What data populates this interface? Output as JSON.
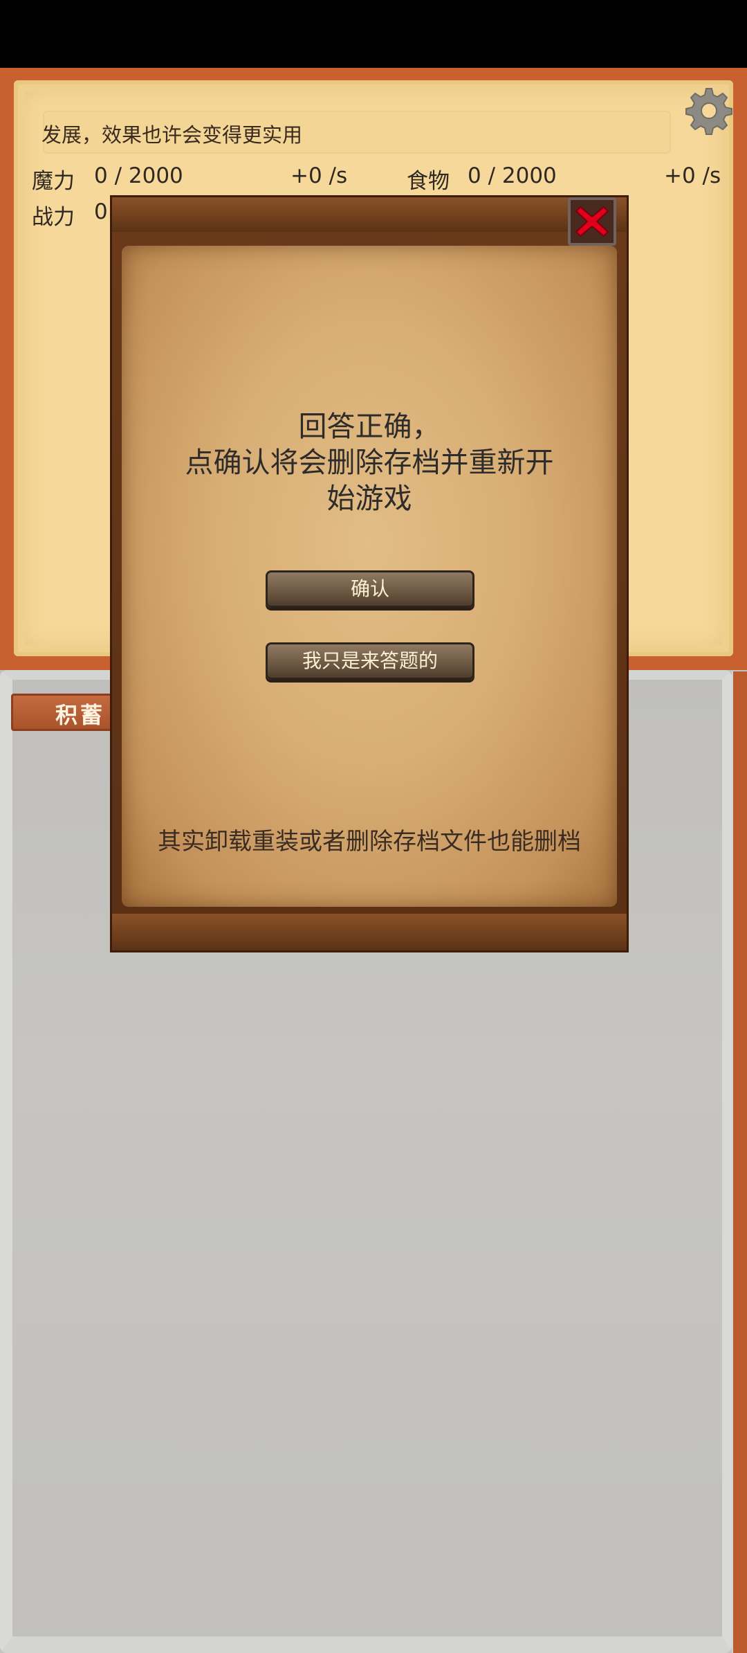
{
  "top_panel": {
    "message": "发展，效果也许会变得更实用",
    "resources": {
      "mana_label": "魔力",
      "mana_value": "0 / 2000",
      "mana_rate": "+0 /s",
      "food_label": "食物",
      "food_value": "0 / 2000",
      "food_rate": "+0 /s",
      "power_label": "战力",
      "power_value": "0"
    }
  },
  "tab": {
    "label": "积蓄"
  },
  "dialog": {
    "title": "回答正确，\n点确认将会删除存档并重新开\n始游戏",
    "confirm_label": "确认",
    "cancel_label": "我只是来答题的",
    "footnote": "其实卸载重装或者删除存档文件也能删档"
  },
  "colors": {
    "panel_border": "#c9602f",
    "panel_fill": "#f6d99a",
    "modal_wood": "#6a3a1b",
    "parchment": "#d7ad74",
    "close_x": "#e0001b",
    "lower_bg": "#c3c2bf"
  },
  "icons": {
    "settings": "gear-icon",
    "close": "close-icon"
  }
}
